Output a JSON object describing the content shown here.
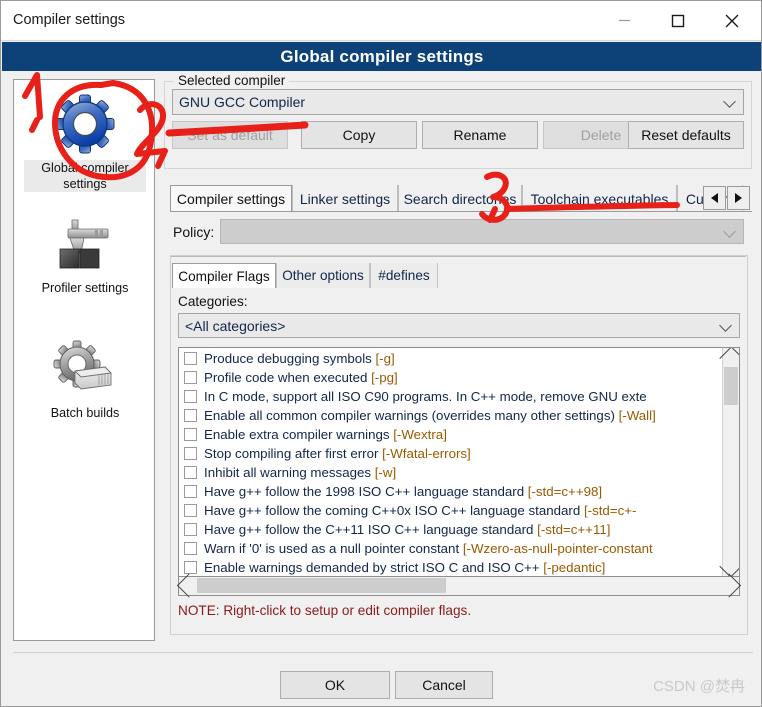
{
  "window": {
    "title": "Compiler settings",
    "minimize_label": "minimize-icon",
    "maximize_label": "maximize-icon",
    "close_label": "close-icon"
  },
  "banner": {
    "title": "Global compiler settings",
    "color": "#0c4278"
  },
  "sidebar": {
    "items": [
      {
        "label": "Global compiler\nsettings",
        "label_line1": "Global compiler",
        "label_line2": "settings",
        "icon": "blue-gear-icon",
        "selected": true
      },
      {
        "label": "Profiler settings",
        "icon": "caliper-icon",
        "selected": false
      },
      {
        "label": "Batch builds",
        "icon": "gear-stack-icon",
        "selected": false
      }
    ]
  },
  "selected_compiler": {
    "group_title": "Selected compiler",
    "combo_value": "GNU GCC Compiler",
    "buttons": [
      {
        "label": "Set as default",
        "disabled": true
      },
      {
        "label": "Copy",
        "disabled": false
      },
      {
        "label": "Rename",
        "disabled": false
      },
      {
        "label": "Delete",
        "disabled": true
      },
      {
        "label": "Reset defaults",
        "disabled": false
      }
    ]
  },
  "outer_tabs": {
    "items": [
      {
        "label": "Compiler settings",
        "active": true
      },
      {
        "label": "Linker settings",
        "active": false
      },
      {
        "label": "Search directories",
        "active": false
      },
      {
        "label": "Toolchain executables",
        "active": false
      },
      {
        "label": "Custom",
        "active": false
      }
    ],
    "nav_prev": "◀",
    "nav_next": "▶"
  },
  "policy": {
    "label": "Policy:",
    "value": "",
    "disabled": true
  },
  "inner_tabs": {
    "items": [
      {
        "label": "Compiler Flags",
        "active": true
      },
      {
        "label": "Other options",
        "active": false
      },
      {
        "label": "#defines",
        "active": false
      }
    ]
  },
  "categories": {
    "label": "Categories:",
    "value": "<All categories>"
  },
  "flags": {
    "items": [
      {
        "text": "Produce debugging symbols",
        "flag": "[-g]",
        "checked": false
      },
      {
        "text": "Profile code when executed",
        "flag": "[-pg]",
        "checked": false
      },
      {
        "text": "In C mode, support all ISO C90 programs. In C++ mode, remove GNU exte",
        "flag": "",
        "checked": false
      },
      {
        "text": "Enable all common compiler warnings (overrides many other settings)",
        "flag": "[-Wall]",
        "checked": false
      },
      {
        "text": "Enable extra compiler warnings",
        "flag": "[-Wextra]",
        "checked": false
      },
      {
        "text": "Stop compiling after first error",
        "flag": "[-Wfatal-errors]",
        "checked": false
      },
      {
        "text": "Inhibit all warning messages",
        "flag": "[-w]",
        "checked": false
      },
      {
        "text": "Have g++ follow the 1998 ISO C++ language standard",
        "flag": "[-std=c++98]",
        "checked": false
      },
      {
        "text": "Have g++ follow the coming C++0x ISO C++ language standard",
        "flag": "[-std=c+-",
        "checked": false
      },
      {
        "text": "Have g++ follow the C++11 ISO C++ language standard",
        "flag": "[-std=c++11]",
        "checked": false
      },
      {
        "text": "Warn if '0' is used as a null pointer constant",
        "flag": "[-Wzero-as-null-pointer-constant",
        "checked": false
      },
      {
        "text": "Enable warnings demanded by strict ISO C and ISO C++",
        "flag": "[-pedantic]",
        "checked": false
      }
    ]
  },
  "note": {
    "text": "NOTE: Right-click to setup or edit compiler flags.",
    "color": "#8b1a1a"
  },
  "footer": {
    "ok_label": "OK",
    "cancel_label": "Cancel",
    "watermark": "CSDN @焚冉"
  },
  "annotations": {
    "color": "#e8201a",
    "marks": [
      {
        "name": "mark-1",
        "text": "1,"
      },
      {
        "name": "mark-2",
        "text": "2,"
      },
      {
        "name": "mark-3",
        "text": "3,"
      }
    ]
  }
}
